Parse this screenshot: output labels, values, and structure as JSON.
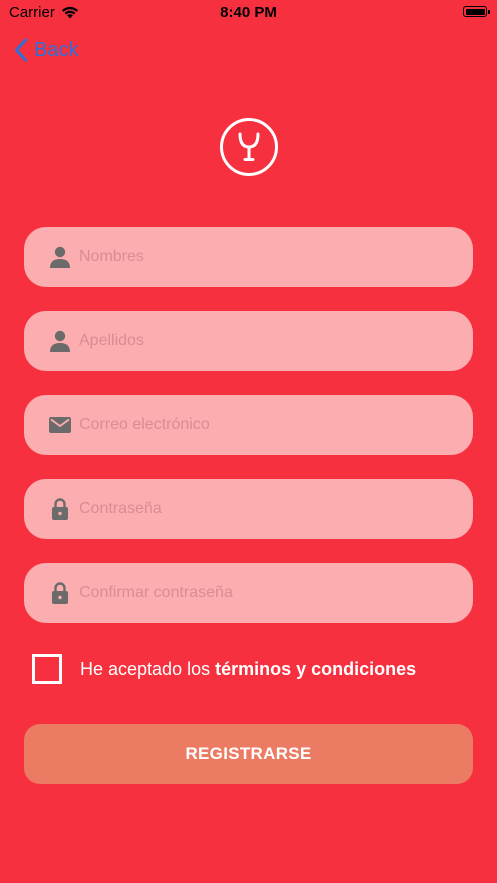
{
  "status_bar": {
    "carrier": "Carrier",
    "time": "8:40 PM"
  },
  "nav": {
    "back_label": "Back"
  },
  "form": {
    "fields": [
      {
        "placeholder": "Nombres",
        "icon": "person-icon"
      },
      {
        "placeholder": "Apellidos",
        "icon": "person-icon"
      },
      {
        "placeholder": "Correo electrónico",
        "icon": "mail-icon"
      },
      {
        "placeholder": "Contraseña",
        "icon": "lock-icon"
      },
      {
        "placeholder": "Confirmar contraseña",
        "icon": "lock-icon"
      }
    ],
    "terms_prefix": "He aceptado los ",
    "terms_link": "términos y condiciones",
    "submit_label": "REGISTRARSE"
  },
  "colors": {
    "background": "#f6303f",
    "field_background": "#fcadb0",
    "button_background": "#ec7b63",
    "back_link": "#2f6fd8"
  }
}
